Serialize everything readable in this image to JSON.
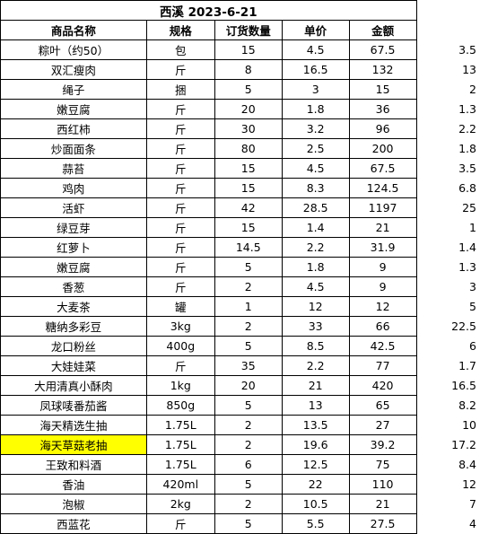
{
  "title": "西溪    2023-6-21",
  "headers": [
    "商品名称",
    "规格",
    "订货数量",
    "单价",
    "金额"
  ],
  "rows": [
    {
      "name": "粽叶（约50）",
      "spec": "包",
      "qty": "15",
      "price": "4.5",
      "amount": "67.5",
      "extra": "3.5"
    },
    {
      "name": "双汇瘦肉",
      "spec": "斤",
      "qty": "8",
      "price": "16.5",
      "amount": "132",
      "extra": "13"
    },
    {
      "name": "绳子",
      "spec": "捆",
      "qty": "5",
      "price": "3",
      "amount": "15",
      "extra": "2"
    },
    {
      "name": "嫩豆腐",
      "spec": "斤",
      "qty": "20",
      "price": "1.8",
      "amount": "36",
      "extra": "1.3"
    },
    {
      "name": "西红柿",
      "spec": "斤",
      "qty": "30",
      "price": "3.2",
      "amount": "96",
      "extra": "2.2"
    },
    {
      "name": "炒面面条",
      "spec": "斤",
      "qty": "80",
      "price": "2.5",
      "amount": "200",
      "extra": "1.8"
    },
    {
      "name": "蒜苔",
      "spec": "斤",
      "qty": "15",
      "price": "4.5",
      "amount": "67.5",
      "extra": "3.5"
    },
    {
      "name": "鸡肉",
      "spec": "斤",
      "qty": "15",
      "price": "8.3",
      "amount": "124.5",
      "extra": "6.8"
    },
    {
      "name": "活虾",
      "spec": "斤",
      "qty": "42",
      "price": "28.5",
      "amount": "1197",
      "extra": "25"
    },
    {
      "name": "绿豆芽",
      "spec": "斤",
      "qty": "15",
      "price": "1.4",
      "amount": "21",
      "extra": "1"
    },
    {
      "name": "红萝卜",
      "spec": "斤",
      "qty": "14.5",
      "price": "2.2",
      "amount": "31.9",
      "extra": "1.4"
    },
    {
      "name": "嫩豆腐",
      "spec": "斤",
      "qty": "5",
      "price": "1.8",
      "amount": "9",
      "extra": "1.3"
    },
    {
      "name": "香葱",
      "spec": "斤",
      "qty": "2",
      "price": "4.5",
      "amount": "9",
      "extra": "3"
    },
    {
      "name": "大麦茶",
      "spec": "罐",
      "qty": "1",
      "price": "12",
      "amount": "12",
      "extra": "5"
    },
    {
      "name": "糖纳多彩豆",
      "spec": "3kg",
      "qty": "2",
      "price": "33",
      "amount": "66",
      "extra": "22.5"
    },
    {
      "name": "龙口粉丝",
      "spec": "400g",
      "qty": "5",
      "price": "8.5",
      "amount": "42.5",
      "extra": "6"
    },
    {
      "name": "大娃娃菜",
      "spec": "斤",
      "qty": "35",
      "price": "2.2",
      "amount": "77",
      "extra": "1.7"
    },
    {
      "name": "大用清真小酥肉",
      "spec": "1kg",
      "qty": "20",
      "price": "21",
      "amount": "420",
      "extra": "16.5"
    },
    {
      "name": "凤球唛番茄酱",
      "spec": "850g",
      "qty": "5",
      "price": "13",
      "amount": "65",
      "extra": "8.2"
    },
    {
      "name": "海天精选生抽",
      "spec": "1.75L",
      "qty": "2",
      "price": "13.5",
      "amount": "27",
      "extra": "10"
    },
    {
      "name": "海天草菇老抽",
      "spec": "1.75L",
      "qty": "2",
      "price": "19.6",
      "amount": "39.2",
      "extra": "17.2",
      "highlight": true
    },
    {
      "name": "王致和料酒",
      "spec": "1.75L",
      "qty": "6",
      "price": "12.5",
      "amount": "75",
      "extra": "8.4"
    },
    {
      "name": "香油",
      "spec": "420ml",
      "qty": "5",
      "price": "22",
      "amount": "110",
      "extra": "12"
    },
    {
      "name": "泡椒",
      "spec": "2kg",
      "qty": "2",
      "price": "10.5",
      "amount": "21",
      "extra": "7"
    },
    {
      "name": "西蓝花",
      "spec": "斤",
      "qty": "5",
      "price": "5.5",
      "amount": "27.5",
      "extra": "4"
    }
  ],
  "colors": {
    "highlight": "#ffff00",
    "border": "#000000",
    "background": "#ffffff"
  }
}
